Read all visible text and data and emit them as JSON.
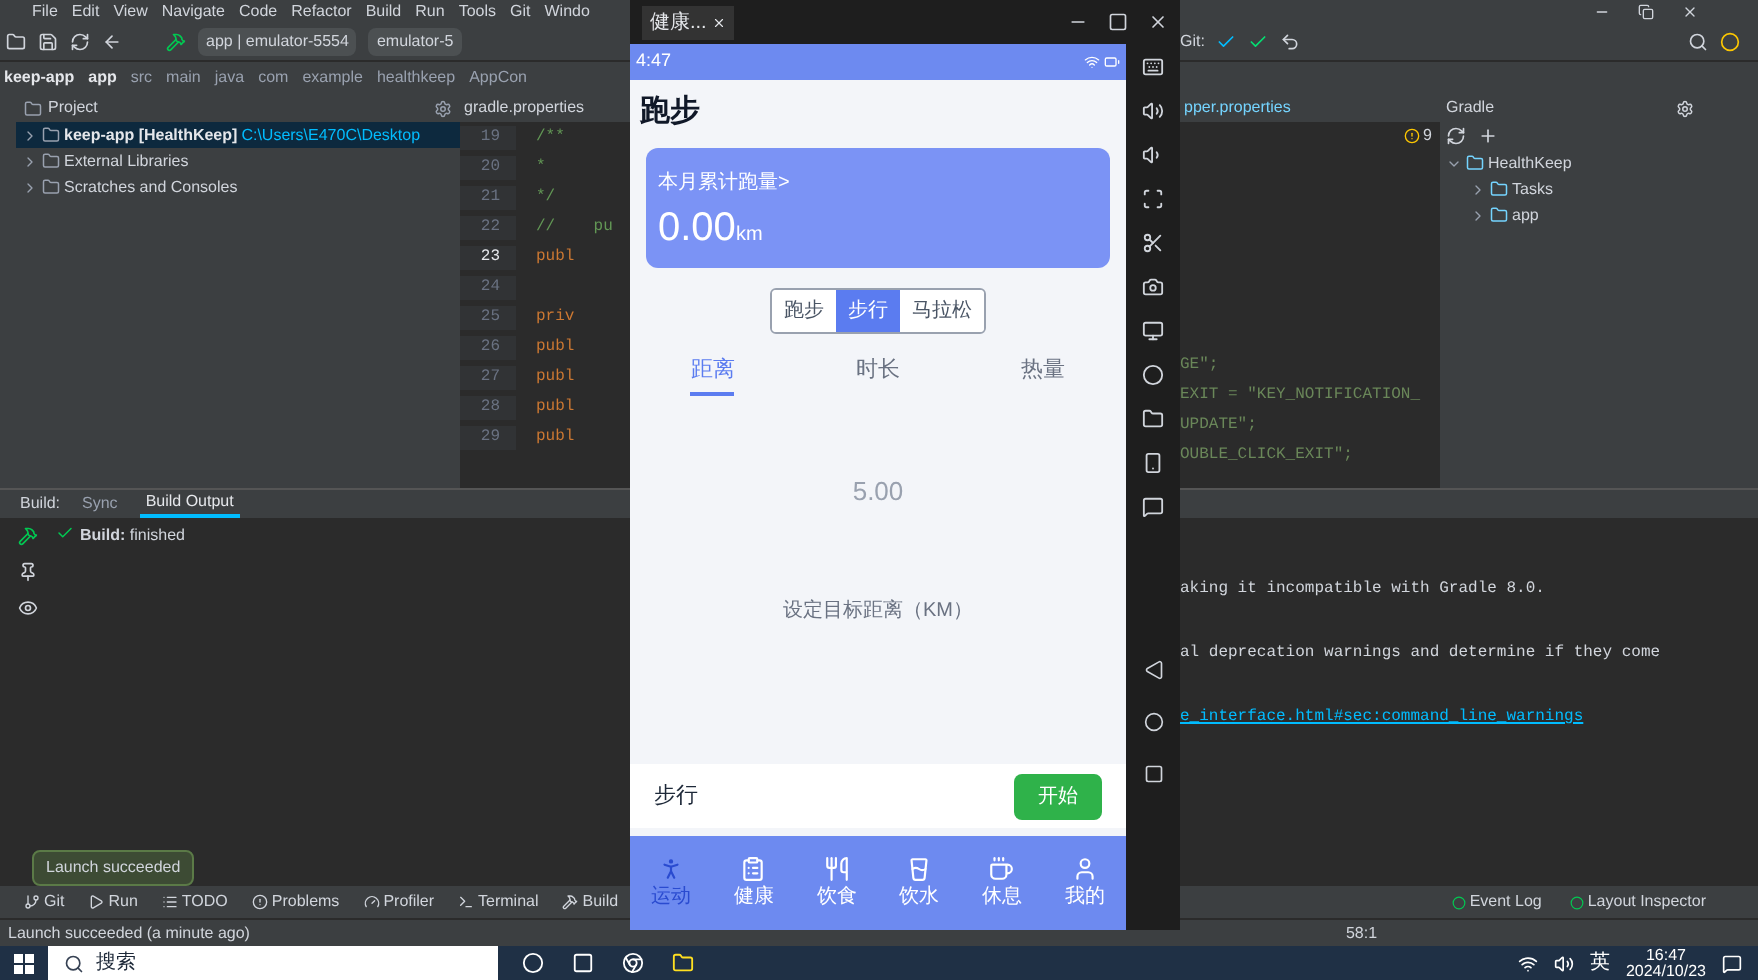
{
  "ide": {
    "menu": [
      "File",
      "Edit",
      "View",
      "Navigate",
      "Code",
      "Refactor",
      "Build",
      "Run",
      "Tools",
      "Git",
      "Windo"
    ],
    "toolbar": {
      "run_config": "app | emulator-5554",
      "device": "emulator-5",
      "git_label": "Git:"
    },
    "breadcrumbs": [
      "keep-app",
      "app",
      "src",
      "main",
      "java",
      "com",
      "example",
      "healthkeep",
      "AppCon"
    ],
    "project_panel": {
      "title": "Project",
      "items": [
        {
          "label": "keep-app [HealthKeep]",
          "path": "C:\\Users\\E470C\\Desktop",
          "selected": true
        },
        {
          "label": "External Libraries",
          "selected": false
        },
        {
          "label": "Scratches and Consoles",
          "selected": false
        }
      ]
    },
    "editor_left": {
      "tab": "gradle.properties",
      "lines": [
        {
          "number": "19",
          "code": "/**",
          "current": false
        },
        {
          "number": "20",
          "code": "*",
          "current": false
        },
        {
          "number": "21",
          "code": "*/",
          "current": false
        },
        {
          "number": "22",
          "code": "//    pu",
          "current": false
        },
        {
          "number": "23",
          "code": "publ",
          "current": true
        },
        {
          "number": "24",
          "current": false
        },
        {
          "number": "25",
          "code": "priv",
          "current": false
        },
        {
          "number": "26",
          "code": "publ",
          "current": false
        },
        {
          "number": "27",
          "code": "publ",
          "current": false
        },
        {
          "number": "28",
          "code": "publ",
          "current": false
        },
        {
          "number": "29",
          "code": "publ",
          "current": false
        }
      ]
    },
    "editor_right": {
      "tab": "pper.properties",
      "warnings": "9",
      "lines": [
        "GE\";",
        "EXIT = \"KEY_NOTIFICATION_",
        "UPDATE\";",
        "OUBLE_CLICK_EXIT\";"
      ]
    },
    "gradle_panel": {
      "title": "Gradle",
      "tree": [
        {
          "label": "HealthKeep",
          "expanded": true,
          "children": [
            {
              "label": "Tasks",
              "expanded": false
            },
            {
              "label": "app",
              "expanded": false
            }
          ]
        }
      ]
    },
    "build_panel": {
      "label": "Build:",
      "tabs": [
        {
          "label": "Sync",
          "selected": false
        },
        {
          "label": "Build Output",
          "selected": true
        }
      ],
      "message": "**Build:** finished",
      "output": [
        "aking it incompatible with Gradle 8.0.",
        "al deprecation warnings and determine if they come"
      ],
      "link": "e_interface.html#sec:command_line_warnings"
    },
    "toast": "Launch succeeded",
    "tool_tabs": [
      "Git",
      "Run",
      "TODO",
      "Problems",
      "Profiler",
      "Terminal",
      "Build"
    ],
    "right_tool_tabs": [
      "Event Log",
      "Layout Inspector"
    ],
    "status_bar": {
      "message": "Launch succeeded (a minute ago)",
      "position": "58:1"
    }
  },
  "emulator": {
    "tab": "健康...",
    "time": "4:47",
    "page_title": "跑步",
    "card": {
      "label": "本月累计跑量>",
      "value": "0.00",
      "unit": "km"
    },
    "modes": [
      {
        "label": "跑步",
        "selected": false
      },
      {
        "label": "步行",
        "selected": true
      },
      {
        "label": "马拉松",
        "selected": false
      }
    ],
    "metric_tabs": [
      {
        "label": "距离",
        "selected": true
      },
      {
        "label": "时长",
        "selected": false
      },
      {
        "label": "热量",
        "selected": false
      }
    ],
    "target_value": "5.00",
    "target_hint": "设定目标距离（KM）",
    "footer": {
      "mode": "步行",
      "start": "开始"
    },
    "nav": [
      {
        "label": "运动",
        "selected": true
      },
      {
        "label": "健康",
        "selected": false
      },
      {
        "label": "饮食",
        "selected": false
      },
      {
        "label": "饮水",
        "selected": false
      },
      {
        "label": "休息",
        "selected": false
      },
      {
        "label": "我的",
        "selected": false
      }
    ]
  },
  "taskbar": {
    "search": "搜索",
    "language": "英",
    "time": "16:47",
    "date": "2024/10/23"
  }
}
